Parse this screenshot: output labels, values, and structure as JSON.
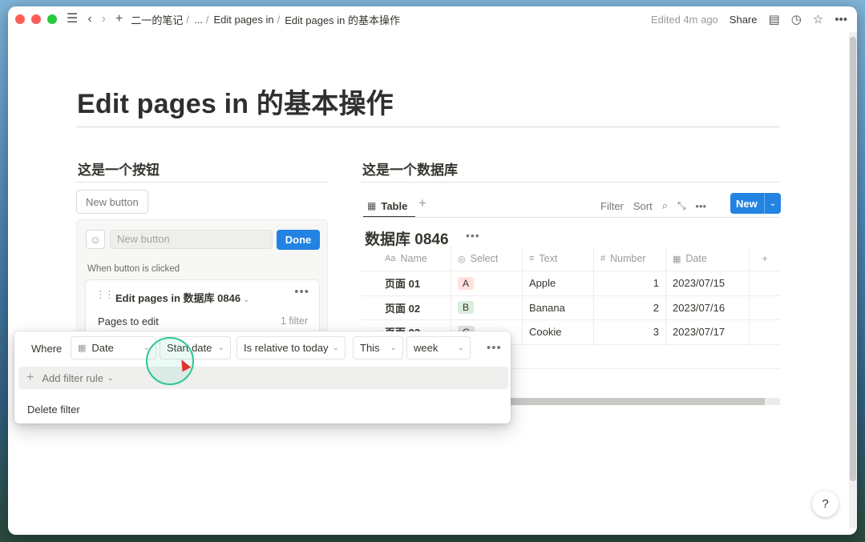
{
  "topbar": {
    "breadcrumbs": [
      "二一的笔记",
      "...",
      "Edit pages in",
      "Edit pages in 的基本操作"
    ],
    "edited": "Edited 4m ago",
    "share": "Share"
  },
  "page": {
    "title": "Edit pages in 的基本操作"
  },
  "button_block": {
    "heading": "这是一个按钮",
    "new_button_label": "New button",
    "name_placeholder": "New button",
    "done_label": "Done",
    "when_label": "When button is clicked",
    "action_title": "Edit pages in 数据库 0846",
    "pages_to_edit_label": "Pages to edit",
    "pages_to_edit_value": "1 filter"
  },
  "database": {
    "heading": "这是一个数据库",
    "view_tab": "Table",
    "tools": {
      "filter": "Filter",
      "sort": "Sort"
    },
    "new_label": "New",
    "title": "数据库 0846",
    "columns": [
      {
        "icon": "Aa",
        "label": "Name"
      },
      {
        "icon": "◎",
        "label": "Select"
      },
      {
        "icon": "≡",
        "label": "Text"
      },
      {
        "icon": "#",
        "label": "Number"
      },
      {
        "icon": "▦",
        "label": "Date"
      }
    ],
    "rows": [
      {
        "name": "页面 01",
        "select": "A",
        "select_color": "#ffe2dd",
        "text": "Apple",
        "number": "1",
        "date": "2023/07/15"
      },
      {
        "name": "页面 02",
        "select": "B",
        "select_color": "#dbeddb",
        "text": "Banana",
        "number": "2",
        "date": "2023/07/16"
      },
      {
        "name": "页面 03",
        "select": "C",
        "select_color": "#e3e2e0",
        "text": "Cookie",
        "number": "3",
        "date": "2023/07/17"
      }
    ]
  },
  "filter_popup": {
    "where": "Where",
    "property": "Date",
    "date_field": "Start date",
    "condition": "Is relative to today",
    "relation": "This",
    "unit": "week",
    "add_rule": "Add filter rule",
    "delete": "Delete filter"
  },
  "help": "?",
  "colors": {
    "accent": "#2383e2",
    "click_ring": "#2bc88f"
  }
}
